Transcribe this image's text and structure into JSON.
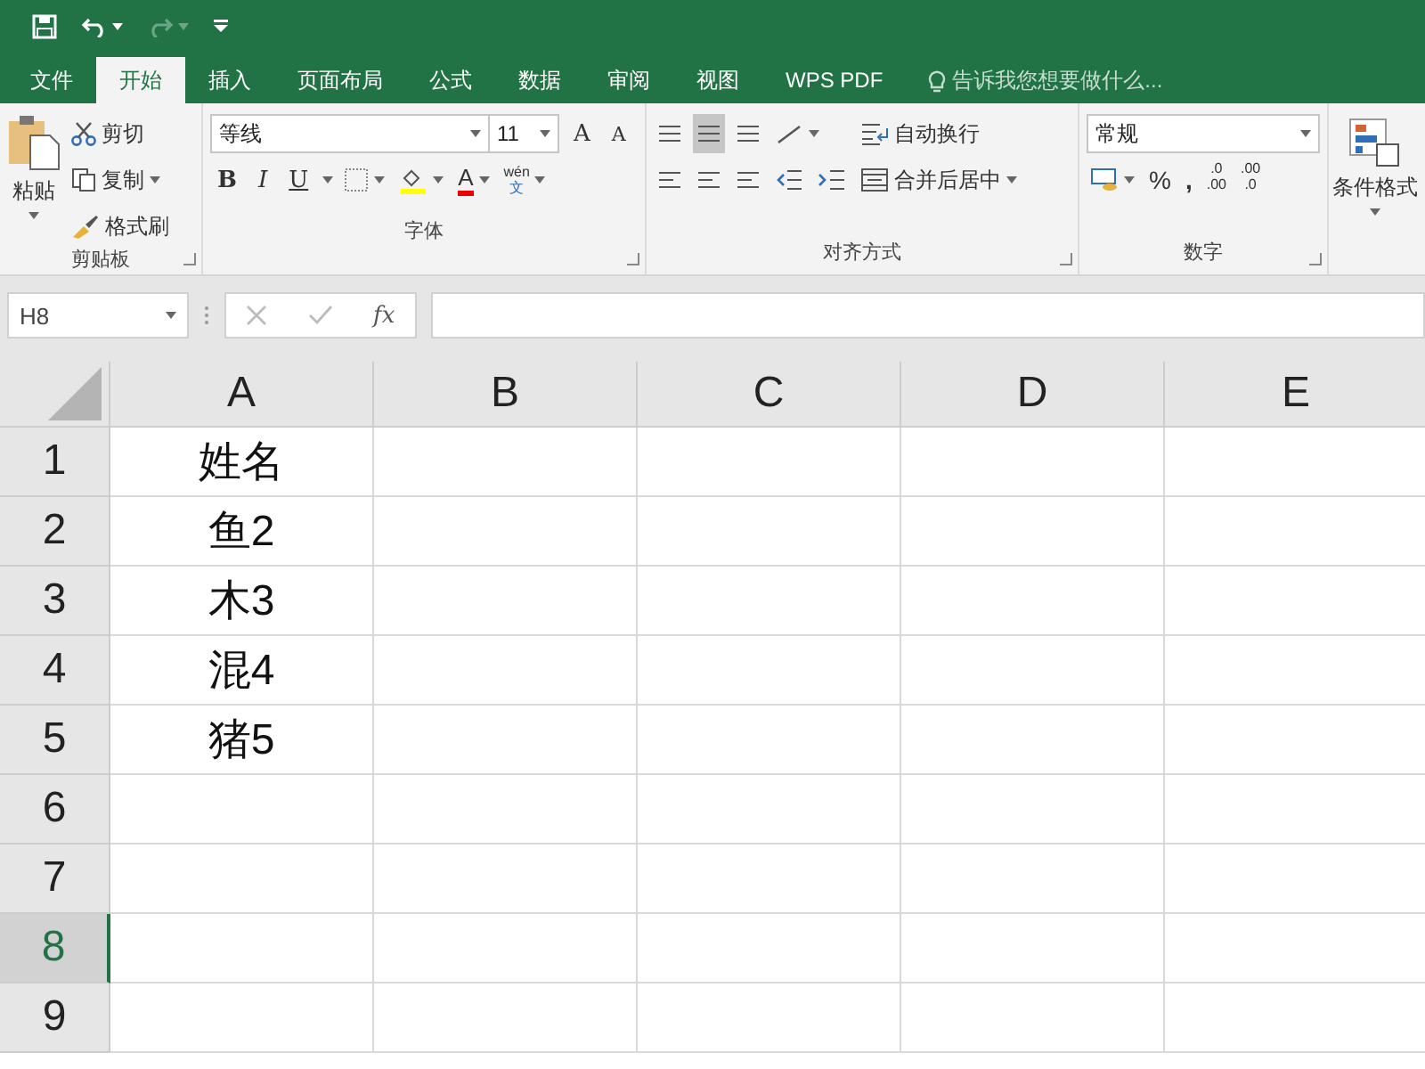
{
  "menu_tabs": [
    {
      "label": "文件",
      "selected": false
    },
    {
      "label": "开始",
      "selected": true
    },
    {
      "label": "插入",
      "selected": false
    },
    {
      "label": "页面布局",
      "selected": false
    },
    {
      "label": "公式",
      "selected": false
    },
    {
      "label": "数据",
      "selected": false
    },
    {
      "label": "审阅",
      "selected": false
    },
    {
      "label": "视图",
      "selected": false
    },
    {
      "label": "WPS PDF",
      "selected": false
    }
  ],
  "tell_me": {
    "placeholder": "告诉我您想要做什么..."
  },
  "ribbon": {
    "clipboard": {
      "paste": "粘贴",
      "cut": "剪切",
      "copy": "复制",
      "painter": "格式刷",
      "label": "剪贴板"
    },
    "font": {
      "name": "等线",
      "size": "11",
      "grow": "A",
      "shrink": "A",
      "bold": "B",
      "italic": "I",
      "underline": "U",
      "font_color_letter": "A",
      "phonetic_top": "wén",
      "phonetic_bottom": "文",
      "label": "字体"
    },
    "alignment": {
      "wrap": "自动换行",
      "merge": "合并后居中",
      "label": "对齐方式"
    },
    "number": {
      "format": "常规",
      "percent": "%",
      "comma": ",",
      "increase_decimal": [
        ".0",
        ".00"
      ],
      "decrease_decimal": [
        ".00",
        ".0"
      ],
      "label": "数字"
    },
    "styles": {
      "conditional": "条件格式"
    }
  },
  "formula_bar": {
    "name_box": "H8",
    "fx": "fx"
  },
  "grid": {
    "columns": [
      "A",
      "B",
      "C",
      "D",
      "E"
    ],
    "rows": [
      {
        "header": "1",
        "selected": false,
        "cells": [
          "姓名"
        ]
      },
      {
        "header": "2",
        "selected": false,
        "cells": [
          "鱼2"
        ]
      },
      {
        "header": "3",
        "selected": false,
        "cells": [
          "木3"
        ]
      },
      {
        "header": "4",
        "selected": false,
        "cells": [
          "混4"
        ]
      },
      {
        "header": "5",
        "selected": false,
        "cells": [
          "猪5"
        ]
      },
      {
        "header": "6",
        "selected": false,
        "cells": []
      },
      {
        "header": "7",
        "selected": false,
        "cells": []
      },
      {
        "header": "8",
        "selected": true,
        "cells": []
      },
      {
        "header": "9",
        "selected": false,
        "cells": []
      }
    ]
  }
}
